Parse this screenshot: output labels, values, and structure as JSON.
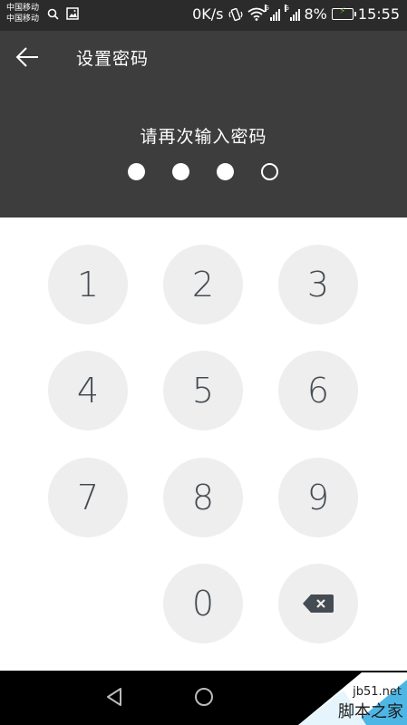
{
  "status_bar": {
    "carrier_1": "中国移动",
    "carrier_2": "中国移动",
    "net_speed": "0K/s",
    "network_1": "G",
    "network_2": "G",
    "battery": "8%",
    "time": "15:55"
  },
  "header": {
    "title": "设置密码",
    "prompt": "请再次输入密码",
    "pin_length": 4,
    "pin_entered": 3
  },
  "keypad": {
    "keys": [
      "1",
      "2",
      "3",
      "4",
      "5",
      "6",
      "7",
      "8",
      "9",
      "0"
    ],
    "backspace_icon": "backspace-icon"
  },
  "nav_bar": {
    "icons": [
      "back-triangle-icon",
      "home-circle-icon"
    ]
  },
  "watermark": {
    "site": "jb51.net",
    "name": "脚本之家"
  },
  "colors": {
    "status_bg": "#2b2b2b",
    "header_bg": "#3d3d3d",
    "key_bg": "#eeeeee",
    "key_text": "#454b52",
    "watermark_blue": "#2fa9e0"
  }
}
